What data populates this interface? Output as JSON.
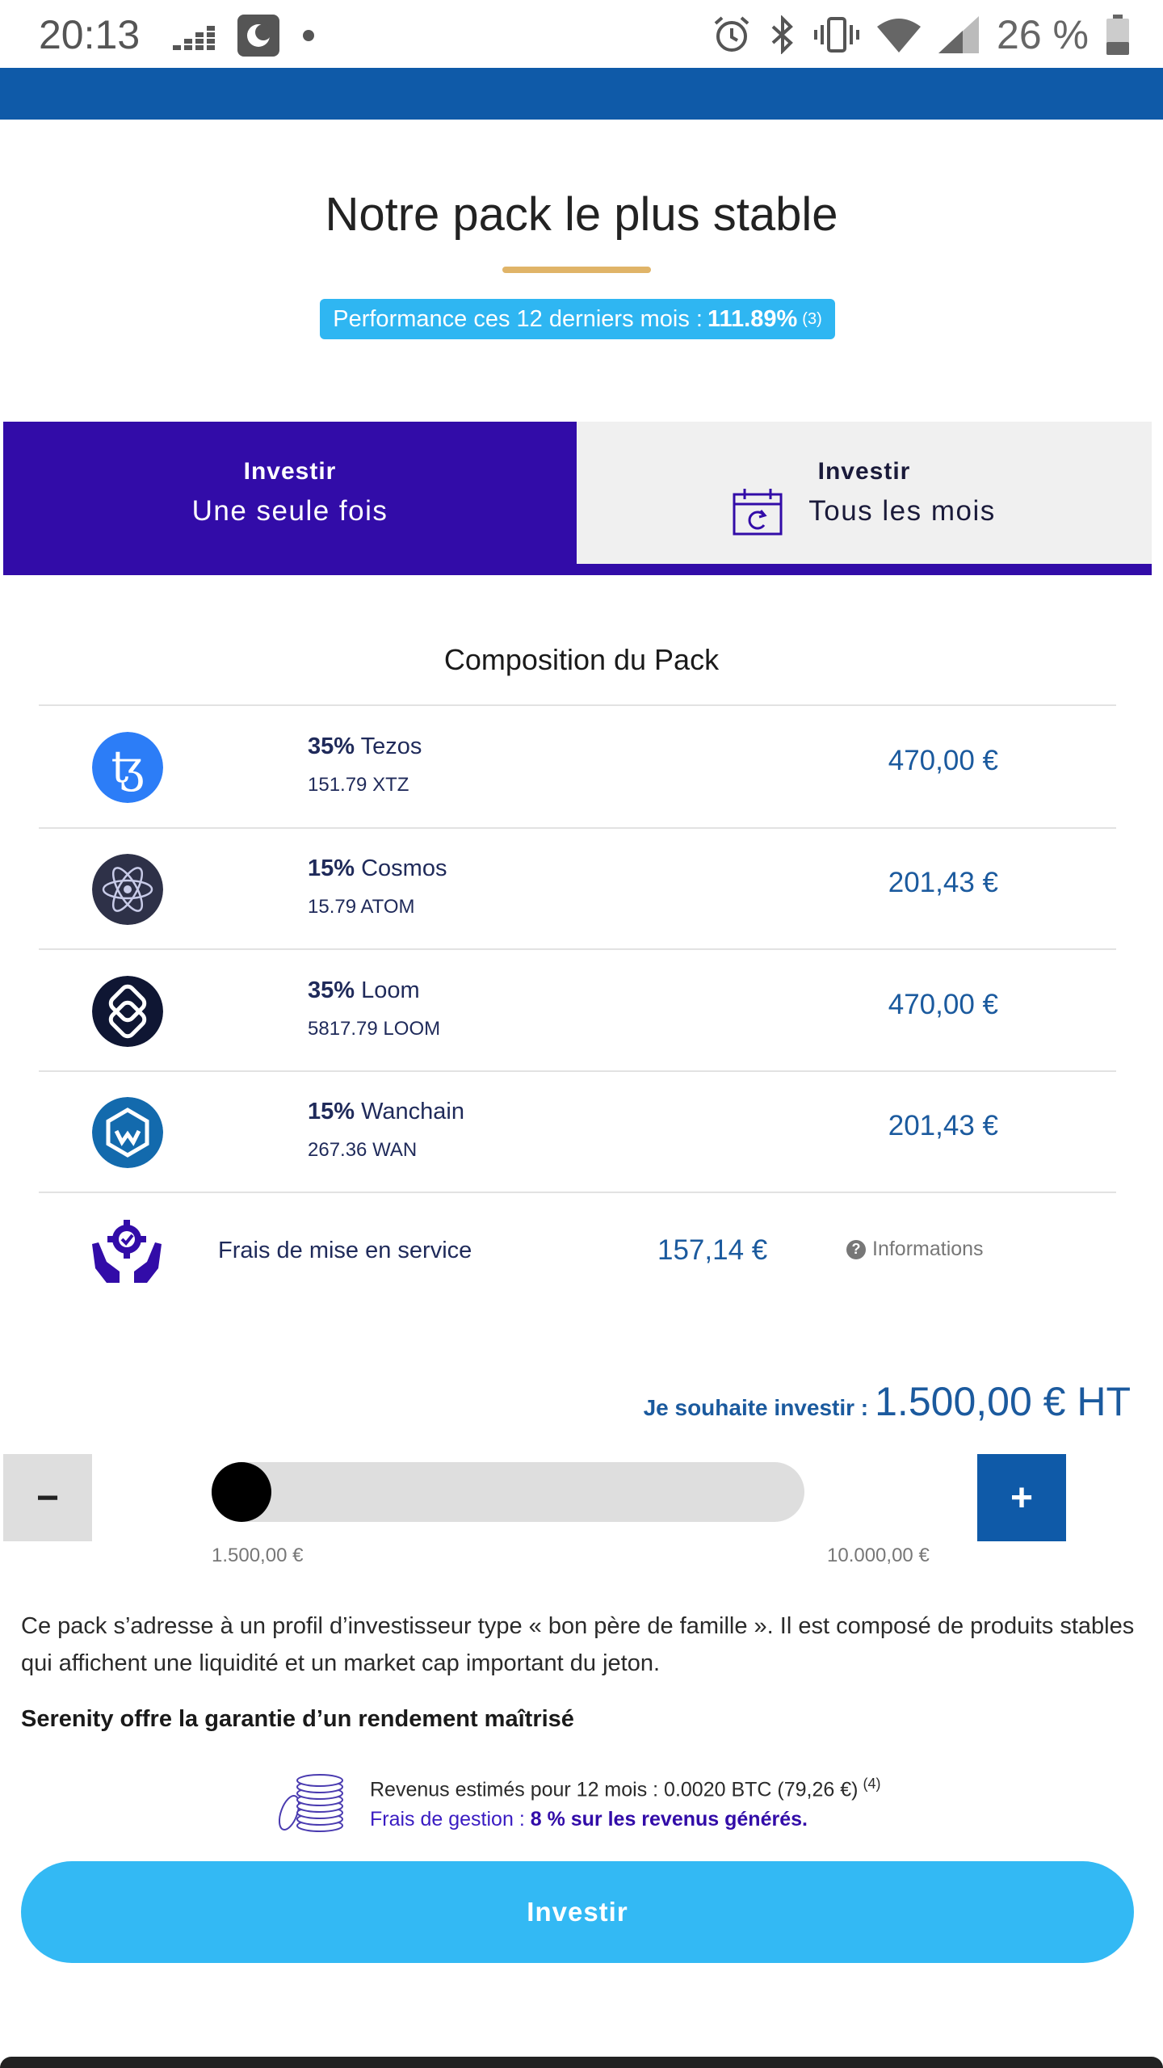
{
  "status_bar": {
    "time": "20:13",
    "battery_text": "26 %",
    "icons": [
      "deezer-icon",
      "app-icon",
      "dot-icon",
      "alarm-icon",
      "bluetooth-icon",
      "vibrate-icon",
      "wifi-icon",
      "signal-icon",
      "battery-icon"
    ]
  },
  "header": {
    "title": "Notre pack le plus stable",
    "performance_label": "Performance ces 12 derniers mois :",
    "performance_value": "111.89%",
    "performance_note": "(3)"
  },
  "tabs": {
    "once": {
      "small": "Investir",
      "big": "Une seule fois"
    },
    "monthly": {
      "small": "Investir",
      "big": "Tous les mois"
    },
    "active": "once"
  },
  "composition": {
    "title": "Composition du Pack",
    "assets": [
      {
        "percent": "35%",
        "name": "Tezos",
        "amount": "151.79 XTZ",
        "value": "470,00 €",
        "icon": "tezos-icon",
        "color": "#2c7df7"
      },
      {
        "percent": "15%",
        "name": "Cosmos",
        "amount": "15.79 ATOM",
        "value": "201,43 €",
        "icon": "cosmos-icon",
        "color": "#2e3148"
      },
      {
        "percent": "35%",
        "name": "Loom",
        "amount": "5817.79 LOOM",
        "value": "470,00 €",
        "icon": "loom-icon",
        "color": "#0f1633"
      },
      {
        "percent": "15%",
        "name": "Wanchain",
        "amount": "267.36 WAN",
        "value": "201,43 €",
        "icon": "wanchain-icon",
        "color": "#136aad"
      }
    ],
    "fees": {
      "label": "Frais de mise en service",
      "value": "157,14 €",
      "info": "Informations"
    }
  },
  "invest": {
    "label": "Je souhaite investir :",
    "value": "1.500,00 € HT",
    "minus": "−",
    "plus": "+",
    "slider_min": "1.500,00 €",
    "slider_max": "10.000,00 €",
    "slider_fraction": 0
  },
  "description": "Ce pack s’adresse à un profil d’investisseur type « bon père de famille ». Il est composé de produits stables qui affichent une liquidité et un market cap important du jeton.",
  "guarantee": "Serenity offre la garantie d’un rendement maîtrisé",
  "revenue": {
    "estimate": "Revenus estimés pour 12 mois : 0.0020 BTC (79,26 €)",
    "estimate_note": "(4)",
    "fees_label": "Frais de gestion :",
    "fees_value": "8 % sur les revenus générés."
  },
  "cta": {
    "label": "Investir"
  },
  "colors": {
    "primary_blue": "#0f5aa8",
    "purple": "#320ca8",
    "cyan": "#33b9f4",
    "gold": "#e0b468"
  }
}
